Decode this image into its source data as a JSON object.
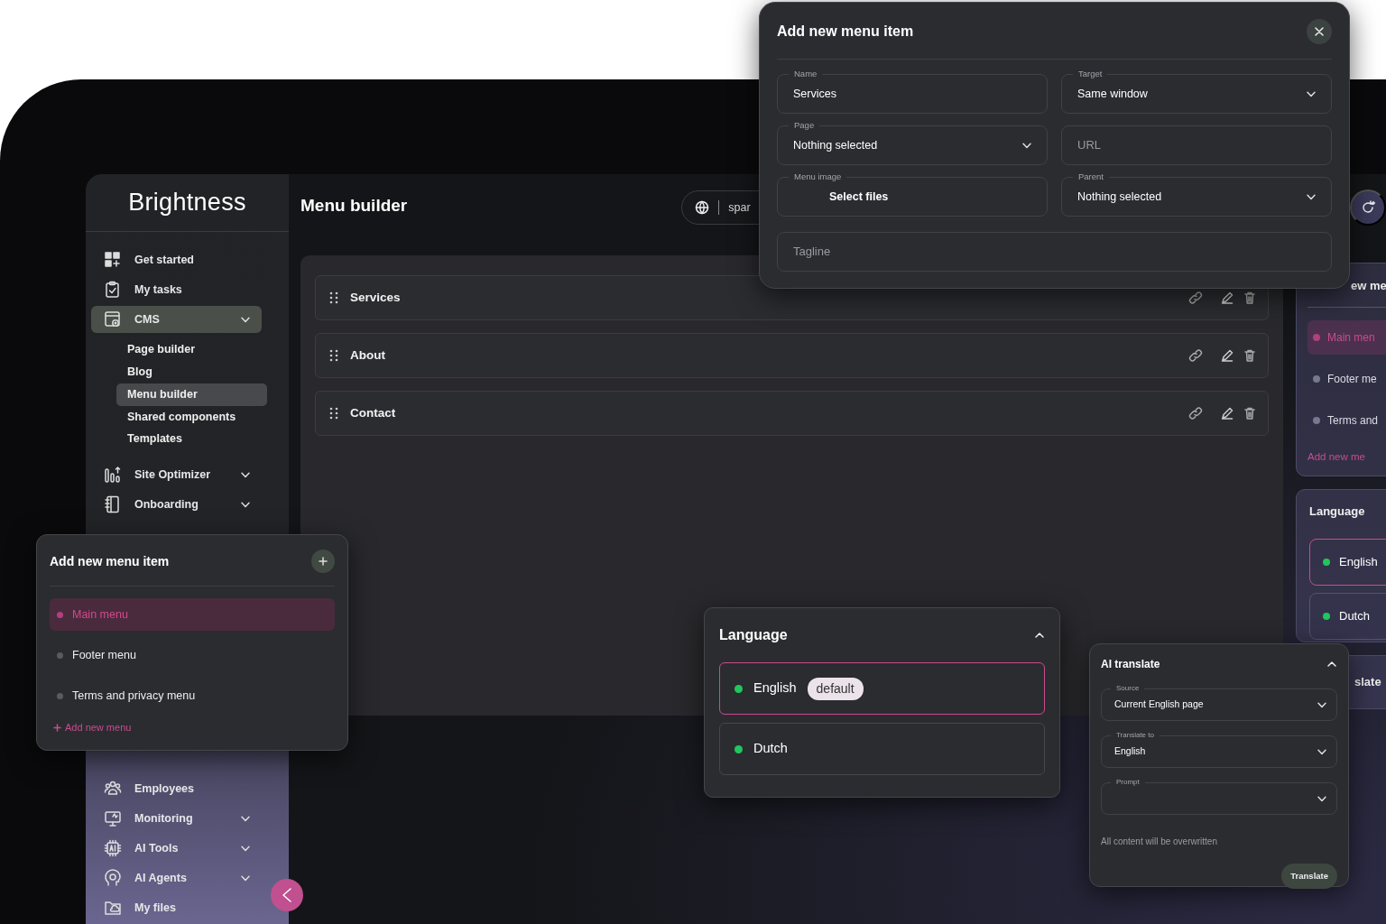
{
  "app": {
    "logo": "Brightness",
    "page_title": "Menu builder",
    "language_pill": "spar"
  },
  "sidebar": {
    "items": [
      {
        "label": "Get started",
        "has_submenu": false,
        "selected": false
      },
      {
        "label": "My tasks",
        "has_submenu": false,
        "selected": false
      },
      {
        "label": "CMS",
        "has_submenu": true,
        "selected": true,
        "expanded": true,
        "children": [
          {
            "label": "Page builder",
            "selected": false
          },
          {
            "label": "Blog",
            "selected": false
          },
          {
            "label": "Menu builder",
            "selected": true
          },
          {
            "label": "Shared components",
            "selected": false
          },
          {
            "label": "Templates",
            "selected": false
          }
        ]
      },
      {
        "label": "Site Optimizer",
        "has_submenu": true,
        "selected": false
      },
      {
        "label": "Onboarding",
        "has_submenu": true,
        "selected": false
      }
    ],
    "lower_items": [
      {
        "label": "Employees",
        "has_submenu": false,
        "selected": false
      },
      {
        "label": "Monitoring",
        "has_submenu": true,
        "selected": false
      },
      {
        "label": "AI Tools",
        "has_submenu": true,
        "selected": false
      },
      {
        "label": "AI Agents",
        "has_submenu": true,
        "selected": false
      },
      {
        "label": "My files",
        "has_submenu": false,
        "selected": false
      }
    ]
  },
  "menu_items": [
    {
      "name": "Services"
    },
    {
      "name": "About"
    },
    {
      "name": "Contact"
    }
  ],
  "modal": {
    "title": "Add new menu item",
    "fields": [
      {
        "kind": "text",
        "label": "Name",
        "value": "Services"
      },
      {
        "kind": "select",
        "label": "Target",
        "value": "Same window"
      },
      {
        "kind": "select",
        "label": "Page",
        "value": "Nothing selected"
      },
      {
        "kind": "text",
        "placeholder": "URL"
      },
      {
        "kind": "file",
        "label": "Menu image",
        "value": "Select files"
      },
      {
        "kind": "select",
        "label": "Parent",
        "value": "Nothing selected"
      },
      {
        "kind": "text",
        "placeholder": "Tagline"
      }
    ]
  },
  "menus_popup": {
    "title": "Add new menu item",
    "menus": [
      {
        "label": "Main menu",
        "selected": true
      },
      {
        "label": "Footer menu",
        "selected": false
      },
      {
        "label": "Terms and privacy menu",
        "selected": false
      }
    ],
    "add_link": "Add new menu"
  },
  "language_panel": {
    "title": "Language",
    "expanded": true,
    "languages": [
      {
        "name": "English",
        "badge": "default",
        "selected": true
      },
      {
        "name": "Dutch",
        "selected": false
      }
    ]
  },
  "ai_translate": {
    "title": "AI translate",
    "expanded": true,
    "fields": [
      {
        "label": "Source",
        "value": "Current English page"
      },
      {
        "label": "Translate to",
        "value": "English"
      },
      {
        "label": "Prompt"
      }
    ],
    "note": "All content will be overwritten",
    "button": "Translate"
  },
  "background_panels": {
    "menus_title": "ew me",
    "menus": [
      {
        "label": "Main men",
        "selected": true
      },
      {
        "label": "Footer me",
        "selected": false
      },
      {
        "label": "Terms and",
        "selected": false
      }
    ],
    "add_link": "Add new me",
    "language_title": "Language",
    "languages": [
      {
        "name": "English",
        "selected": true
      },
      {
        "name": "Dutch",
        "selected": false
      }
    ],
    "translate_title": "slate"
  }
}
